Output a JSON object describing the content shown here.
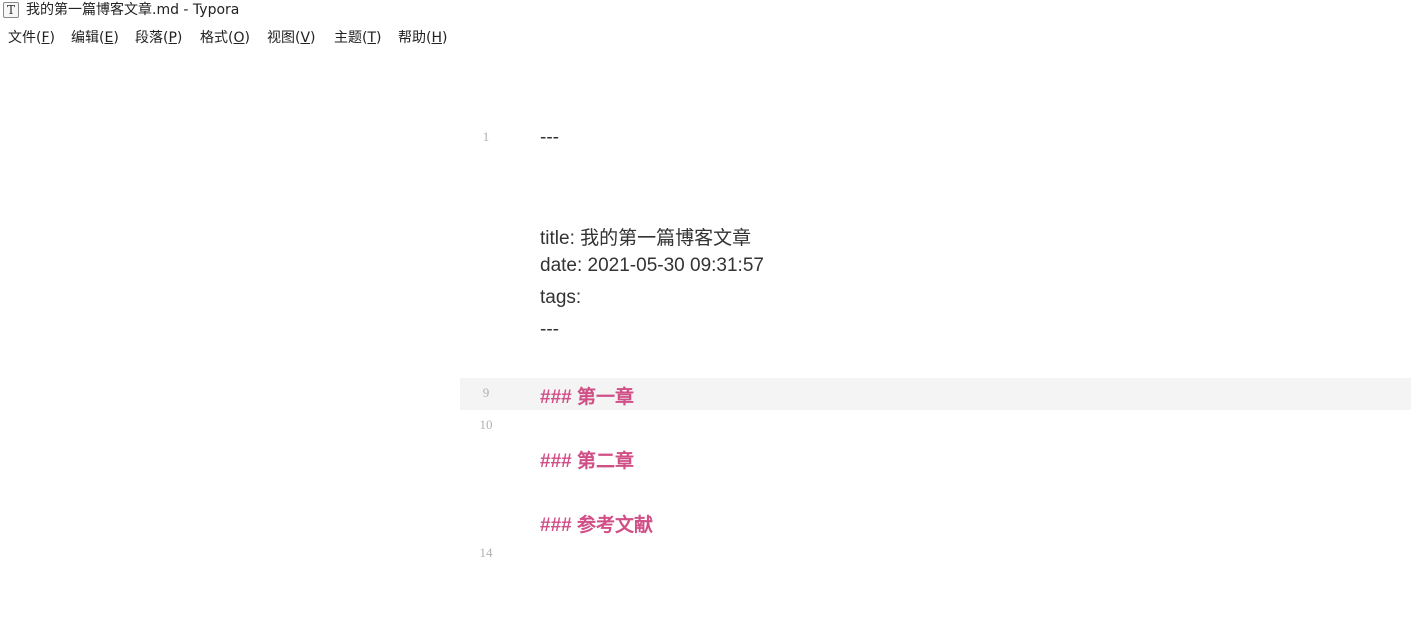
{
  "window": {
    "title": "我的第一篇博客文章.md - Typora",
    "icon_glyph": "T"
  },
  "menu": {
    "items": [
      {
        "label": "文件(",
        "key": "F",
        "close": ")"
      },
      {
        "label": "编辑(",
        "key": "E",
        "close": ")"
      },
      {
        "label": "段落(",
        "key": "P",
        "close": ")"
      },
      {
        "label": "格式(",
        "key": "O",
        "close": ")"
      },
      {
        "label": "视图(",
        "key": "V",
        "close": ")"
      },
      {
        "label": "主题(",
        "key": "T",
        "close": ")"
      },
      {
        "label": "帮助(",
        "key": "H",
        "close": ")"
      }
    ]
  },
  "editor": {
    "line_numbers": [
      "1",
      "9",
      "10",
      "14"
    ],
    "front_matter": {
      "open": "---",
      "title_line": "title: 我的第一篇博客文章",
      "date_line": "date: 2021-05-30 09:31:57",
      "tags_line": "tags:",
      "close": "---"
    },
    "headings": [
      "### 第一章",
      "### 第二章",
      "### 参考文献"
    ],
    "active_line": "9",
    "colors": {
      "heading": "#d04f87",
      "text": "#333333",
      "line_number": "#b0b0b0",
      "active_row": "#f4f4f4"
    }
  }
}
